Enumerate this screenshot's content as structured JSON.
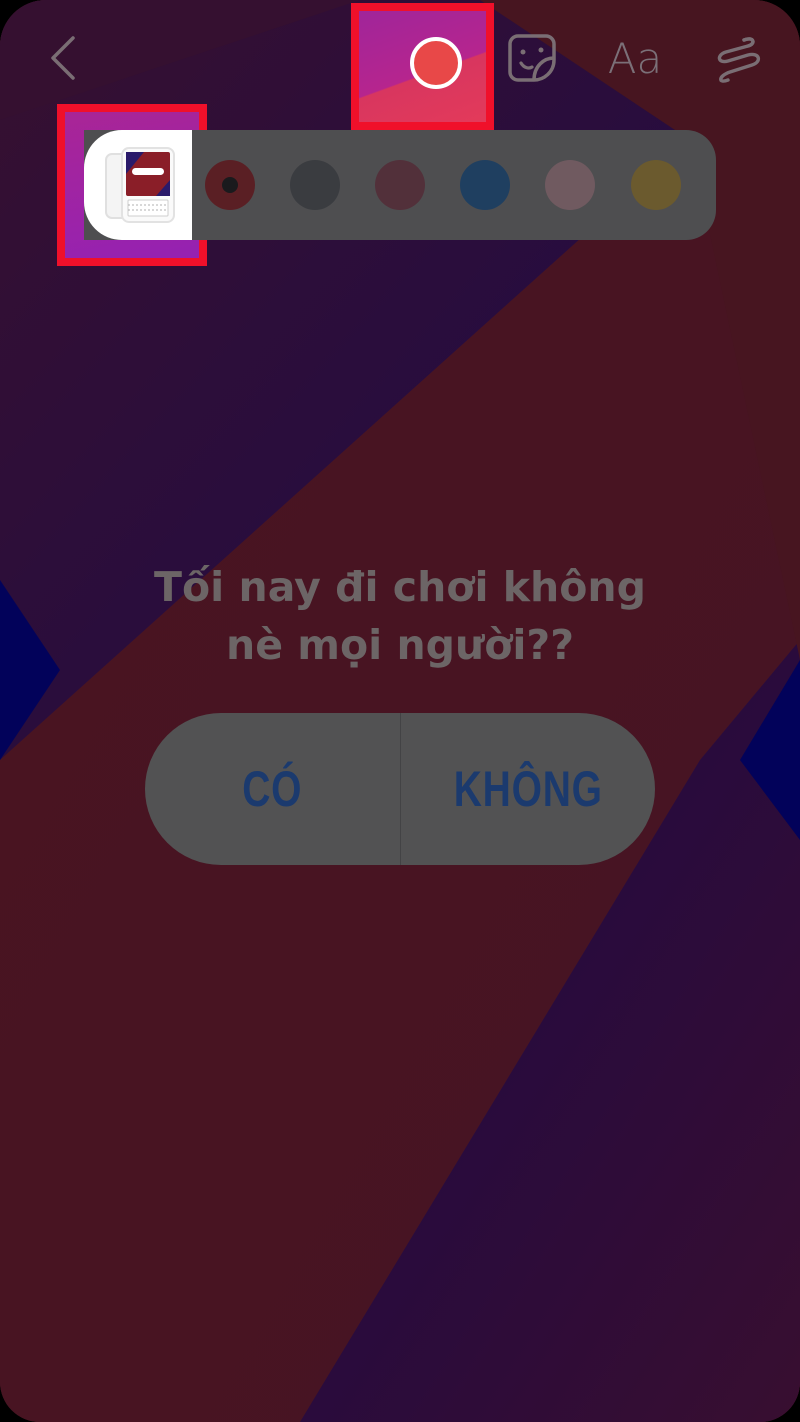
{
  "toolbar": {
    "back_icon": "chevron-left-icon",
    "color_picker": {
      "selected_color": "#e84848"
    },
    "sticker_icon": "sticker-icon",
    "text_label": "Aa",
    "draw_icon": "scribble-icon"
  },
  "sticker_tray": {
    "first_item_icon": "poll-sticker-icon",
    "swatches": [
      {
        "name": "red",
        "color": "#5a1f24",
        "selected": true
      },
      {
        "name": "dark-gray",
        "color": "#3a3c40",
        "selected": false
      },
      {
        "name": "rose",
        "color": "#52303a",
        "selected": false
      },
      {
        "name": "blue",
        "color": "#1f3f60",
        "selected": false
      },
      {
        "name": "pink",
        "color": "#705a60",
        "selected": false
      },
      {
        "name": "gold",
        "color": "#6b5a2e",
        "selected": false
      }
    ]
  },
  "highlight_color": "#f0102a",
  "question": {
    "line1": "Tối nay đi chơi không",
    "line2": "nè mọi người??"
  },
  "poll": {
    "option_yes": "CÓ",
    "option_no": "KHÔNG",
    "text_color": "#1b3a6e"
  }
}
